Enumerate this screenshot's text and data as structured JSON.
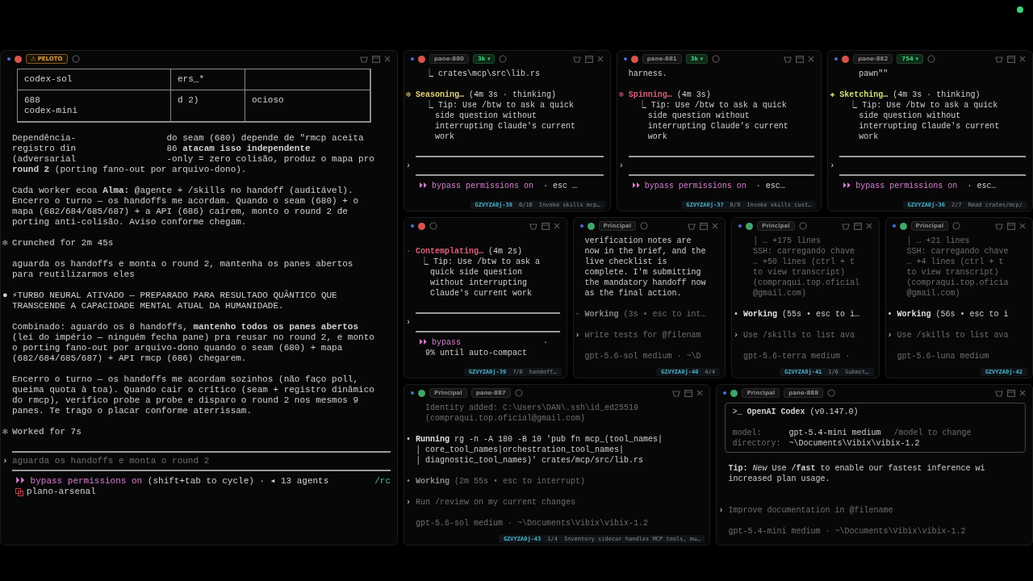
{
  "left_pane": {
    "color": "#d9534f",
    "tags": [
      {
        "kind": "warn",
        "label": "⚠ PELOTO"
      }
    ],
    "lines": [
      {
        "kind": "table",
        "rows": [
          [
            "codex-sol",
            "ers_*"
          ],
          [
            "688\ncodex-mini",
            "d 2)",
            "ocioso"
          ]
        ]
      },
      {
        "kind": "gap"
      },
      {
        "kind": "text",
        "text": "Dependência-                 do seam (680) depende de \"rmcp aceita\nregistro din                 86 **atacam isso independente**\n(adversarial                 -only = zero colisão, produz o mapa pro\n**round 2** (porting fano-out por arquivo-dono)."
      },
      {
        "kind": "gap"
      },
      {
        "kind": "text",
        "text": "Cada worker ecoa **Alma:** @agente + /skills no handoff (auditável).\nEncerro o turno — os handoffs me acordam. Quando o seam (680) + o\nmapa (682/684/685/687) + a API (686) caírem, monto o round 2 de\nporting anti-colisão. Aviso conforme chegam."
      },
      {
        "kind": "gap"
      },
      {
        "kind": "status",
        "glyph": "✻",
        "color": "#a0a0a0",
        "verb": "Crunched",
        "rest": " for 2m 45s"
      },
      {
        "kind": "gap"
      },
      {
        "kind": "text",
        "text": "aguarda os handoffs e monta o round 2, mantenha os panes abertos\npara reutilizarmos eles"
      },
      {
        "kind": "gap"
      },
      {
        "kind": "bullet",
        "glyph": "●",
        "text": "⚡TURBO NEURAL ATIVADO — PREPARADO PARA RESULTADO QUÂNTICO QUE\nTRANSCENDE A CAPACIDADE MENTAL ATUAL DA HUMANIDADE."
      },
      {
        "kind": "gap"
      },
      {
        "kind": "text",
        "text": "Combinado: aguardo os 8 handoffs, **mantenho todos os panes abertos**\n(lei do império — ninguém fecha pane) pra reusar no round 2, e monto\no porting fano-out por arquivo-dono quando o seam (680) + mapa\n(682/684/685/687) + API rmcp (686) chegarem."
      },
      {
        "kind": "gap"
      },
      {
        "kind": "text",
        "text": "Encerro o turno — os handoffs me acordam sozinhos (não faço poll,\nqueima quota à toa). Quando cair o crítico (seam + registro dinâmico\ndo rmcp), verifico probe a probe e disparo o round 2 nos mesmos 9\npanes. Te trago o placar conforme aterrissam."
      },
      {
        "kind": "gap"
      },
      {
        "kind": "status",
        "glyph": "✻",
        "color": "#a0a0a0",
        "verb": "Worked",
        "rest": " for 7s"
      },
      {
        "kind": "gap"
      },
      {
        "kind": "rule"
      },
      {
        "kind": "prompt",
        "mark": "›",
        "placeholder": "aguarda os handoffs e monta o round 2"
      },
      {
        "kind": "rule"
      },
      {
        "kind": "mode",
        "label": "⏵⏵ bypass permissions on",
        "rest": " (shift+tab to cycle) · ◂ 13 agents",
        "right": "/rc"
      },
      {
        "kind": "branch",
        "text": "plano-arsenal"
      }
    ]
  },
  "rows": [
    {
      "panes": [
        {
          "color": "#d9534f",
          "tags": [
            {
              "kind": "tag",
              "label": "pane-880"
            },
            {
              "kind": "count",
              "label": "3k ▾"
            }
          ],
          "lines": [
            {
              "kind": "text",
              "text": "  ⎿ crates\\mcp\\src\\lib.rs"
            },
            {
              "kind": "gap"
            },
            {
              "kind": "status",
              "glyph": "✻",
              "color": "#e3d27c",
              "verb": "Seasoning…",
              "rest": " (4m 3s · thinking)"
            },
            {
              "kind": "text",
              "text": "  ⎿ Tip: Use /btw to ask a quick\n    side question without\n    interrupting Claude's current\n    work"
            },
            {
              "kind": "gap"
            },
            {
              "kind": "rule"
            },
            {
              "kind": "prompt",
              "mark": "›"
            },
            {
              "kind": "rule"
            },
            {
              "kind": "mode",
              "label": "⏵⏵ bypass permissions on",
              "rest": "  · esc …"
            }
          ],
          "footer": {
            "id": "GZVYZA0j-38",
            "count": "0/10",
            "task": "Invoke skills mcp…"
          }
        },
        {
          "color": "#d9534f",
          "tags": [
            {
              "kind": "tag",
              "label": "pane-881"
            },
            {
              "kind": "count",
              "label": "3k ▾"
            }
          ],
          "lines": [
            {
              "kind": "text",
              "text": "harness."
            },
            {
              "kind": "gap"
            },
            {
              "kind": "status",
              "glyph": "✻",
              "color": "#d9607a",
              "verb": "Spinning…",
              "rest": " (4m 3s)"
            },
            {
              "kind": "text",
              "text": "  ⎿ Tip: Use /btw to ask a quick\n    side question without\n    interrupting Claude's current\n    work"
            },
            {
              "kind": "gap"
            },
            {
              "kind": "rule"
            },
            {
              "kind": "prompt",
              "mark": "›"
            },
            {
              "kind": "rule"
            },
            {
              "kind": "mode",
              "label": "⏵⏵ bypass permissions on",
              "rest": "  · esc…"
            }
          ],
          "footer": {
            "id": "GZVYZA0j-37",
            "count": "0/9",
            "task": "Invoke skills cust…"
          }
        },
        {
          "color": "#d9534f",
          "tags": [
            {
              "kind": "tag",
              "label": "pane-882"
            },
            {
              "kind": "count",
              "label": "754 ▾"
            }
          ],
          "lines": [
            {
              "kind": "text",
              "text": "    pawn\"\""
            },
            {
              "kind": "gap"
            },
            {
              "kind": "status",
              "glyph": "✚",
              "color": "#d6de7a",
              "verb": "Sketching…",
              "rest": " (4m 3s · thinking)"
            },
            {
              "kind": "text",
              "text": "  ⎿ Tip: Use /btw to ask a quick\n    side question without\n    interrupting Claude's current\n    work"
            },
            {
              "kind": "gap"
            },
            {
              "kind": "rule"
            },
            {
              "kind": "prompt",
              "mark": "›"
            },
            {
              "kind": "rule"
            },
            {
              "kind": "mode",
              "label": "⏵⏵ bypass permissions on",
              "rest": "  · esc…"
            }
          ],
          "footer": {
            "id": "GZVYZA0j-36",
            "count": "2/7",
            "task": "Read crates/mcp/"
          }
        }
      ]
    },
    {
      "panes": [
        {
          "color": "#d9534f",
          "lines": [
            {
              "kind": "gap"
            },
            {
              "kind": "status",
              "glyph": "·",
              "color": "#d9607a",
              "verb": "Contemplating…",
              "rest": " (4m 2s)"
            },
            {
              "kind": "text",
              "text": " ⎿ Tip: Use /btw to ask a\n   quick side question\n   without interrupting\n   Claude's current work"
            },
            {
              "kind": "gap"
            },
            {
              "kind": "rule"
            },
            {
              "kind": "prompt",
              "mark": "›"
            },
            {
              "kind": "rule"
            },
            {
              "kind": "mode",
              "label": "⏵⏵ bypass",
              "rest": "                 ·"
            },
            {
              "kind": "text",
              "text": "  9% until auto-compact"
            }
          ],
          "footer": {
            "id": "GZVYZA0j-39",
            "count": "7/8",
            "task": "handoff…"
          }
        },
        {
          "color": "#3fa66a",
          "tags": [
            {
              "kind": "tag",
              "label": "Principal"
            }
          ],
          "lines": [
            {
              "kind": "text",
              "text": "verification notes are\nnow in the brief, and the\nlive checklist is\ncomplete. I'm submitting\nthe mandatory handoff now\nas the final action."
            },
            {
              "kind": "gap"
            },
            {
              "kind": "status",
              "glyph": "◦",
              "color": "#8a8a8a",
              "dim": true,
              "verb": "Working",
              "rest": " (3s • esc to int…"
            },
            {
              "kind": "gap"
            },
            {
              "kind": "prompt",
              "mark": "›",
              "placeholder": "Write tests for @filenam"
            },
            {
              "kind": "gap"
            },
            {
              "kind": "model",
              "text": "gpt-5.6-sol medium · ~\\D"
            }
          ],
          "footer": {
            "id": "GZVYZA0j-40",
            "count": "4/4"
          }
        },
        {
          "color": "#3fa66a",
          "tags": [
            {
              "kind": "tag",
              "label": "Principal"
            }
          ],
          "lines": [
            {
              "kind": "dim",
              "text": "  │ … +175 lines\n  SSH: carregando chave\n  … +50 lines (ctrl + t\n  to view transcript)\n  (compraqui.top.oficial\n  @gmail.com)"
            },
            {
              "kind": "gap"
            },
            {
              "kind": "status",
              "glyph": "•",
              "color": "#e0e0e0",
              "verb": "Working",
              "rest": " (55s • esc to i…"
            },
            {
              "kind": "gap"
            },
            {
              "kind": "prompt",
              "mark": "›",
              "placeholder": "Use /skills to list ava"
            },
            {
              "kind": "gap"
            },
            {
              "kind": "model",
              "text": "gpt-5.6-terra medium ·"
            }
          ],
          "footer": {
            "id": "GZVYZA0j-41",
            "count": "1/6",
            "task": "Submit…"
          }
        },
        {
          "color": "#3fa66a",
          "tags": [
            {
              "kind": "tag",
              "label": "Principal"
            }
          ],
          "lines": [
            {
              "kind": "dim",
              "text": "  │ … +21 lines\n  SSH: carregando chave\n  … +4 lines (ctrl + t\n  to view transcript)\n  (compraqui.top.oficia\n  @gmail.com)"
            },
            {
              "kind": "gap"
            },
            {
              "kind": "status",
              "glyph": "•",
              "color": "#e0e0e0",
              "verb": "Working",
              "rest": " (56s • esc to i"
            },
            {
              "kind": "gap"
            },
            {
              "kind": "prompt",
              "mark": "›",
              "placeholder": "Use /skills to list ava"
            },
            {
              "kind": "gap"
            },
            {
              "kind": "model",
              "text": "gpt-5.6-luna medium"
            }
          ],
          "footer": {
            "id": "GZVYZA0j-42"
          }
        }
      ]
    },
    {
      "panes": [
        {
          "color": "#3fa66a",
          "tags": [
            {
              "kind": "tag",
              "label": "Principal"
            },
            {
              "kind": "tag",
              "label": "pane-887"
            }
          ],
          "lines": [
            {
              "kind": "dim",
              "text": "  Identity added: C:\\Users\\DAN\\.ssh\\id_ed25519\n  (compraqui.top.oficial@gmail.com)"
            },
            {
              "kind": "gap"
            },
            {
              "kind": "status",
              "glyph": "•",
              "color": "#e0e0e0",
              "verb": "Running",
              "rest": " rg -n -A 180 -B 10 'pub fn mcp_(tool_names|\n│ core_tool_names|orchestration_tool_names|\n│ diagnostic_tool_names)' crates/mcp/src/lib.rs"
            },
            {
              "kind": "gap"
            },
            {
              "kind": "status",
              "glyph": "•",
              "color": "#8a8a8a",
              "dim": true,
              "verb": "Working",
              "rest": " (2m 55s • esc to interrupt)"
            },
            {
              "kind": "gap"
            },
            {
              "kind": "prompt",
              "mark": "›",
              "placeholder": "Run /review on my current changes"
            },
            {
              "kind": "gap"
            },
            {
              "kind": "model",
              "text": "gpt-5.6-sol medium · ~\\Documents\\Vibix\\vibix-1.2"
            }
          ],
          "footer": {
            "id": "GZVYZA0j-43",
            "count": "1/4",
            "task": "Inventory sidecar handles MCP tools, mu…"
          }
        },
        {
          "color": "#3fa66a",
          "tags": [
            {
              "kind": "tag",
              "label": "Principal"
            },
            {
              "kind": "tag",
              "label": "pane-888"
            }
          ],
          "lines": [
            {
              "kind": "box",
              "title": ">_ **OpenAI Codex** (v0.147.0)",
              "rows": [
                {
                  "key": "model:",
                  "value": "gpt-5.4-mini medium",
                  "hint": "/model to change"
                },
                {
                  "key": "directory:",
                  "value": "~\\Documents\\Vibix\\vibix-1.2"
                }
              ]
            },
            {
              "kind": "gap"
            },
            {
              "kind": "text",
              "text": "**Tip:** *New* Use **/fast** to enable our fastest inference wi\nincreased plan usage."
            },
            {
              "kind": "gap"
            },
            {
              "kind": "gap"
            },
            {
              "kind": "prompt",
              "mark": "›",
              "placeholder": "Improve documentation in @filename"
            },
            {
              "kind": "gap"
            },
            {
              "kind": "model",
              "text": "gpt-5.4-mini medium · ~\\Documents\\Vibix\\vibix-1.2"
            }
          ]
        }
      ]
    }
  ]
}
